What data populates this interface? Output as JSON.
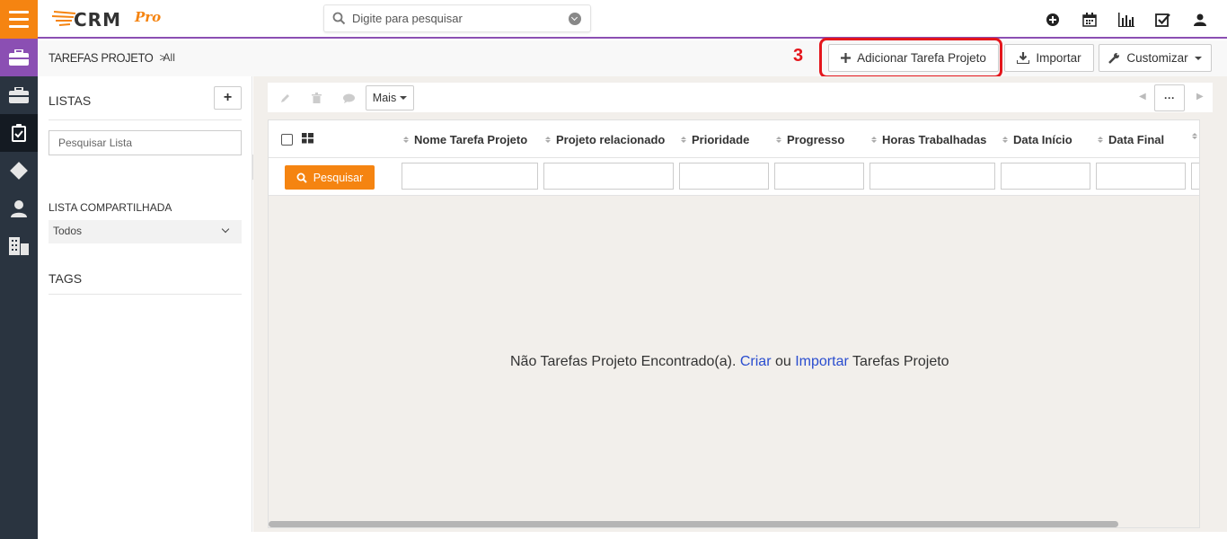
{
  "app": {
    "logo_text": "CRM",
    "logo_suffix": "Pro"
  },
  "search": {
    "placeholder": "Digite para pesquisar"
  },
  "header": {
    "title": "TAREFAS PROJETO",
    "breadcrumb_sep": ">",
    "breadcrumb_all": "All"
  },
  "annotation": {
    "step_number": "3",
    "color": "#e4161c"
  },
  "actions": {
    "add_label": "Adicionar Tarefa Projeto",
    "import_label": "Importar",
    "customize_label": "Customizar"
  },
  "sidebar": {
    "lists_label": "LISTAS",
    "add_symbol": "+",
    "search_list_placeholder": "Pesquisar Lista",
    "shared_list_label": "LISTA COMPARTILHADA",
    "shared_list_value": "Todos",
    "tags_label": "TAGS"
  },
  "toolbar": {
    "more_label": "Mais",
    "dots_label": "···"
  },
  "table": {
    "columns": [
      {
        "label": "Nome Tarefa Projeto"
      },
      {
        "label": "Projeto relacionado"
      },
      {
        "label": "Prioridade"
      },
      {
        "label": "Progresso"
      },
      {
        "label": "Horas Trabalhadas"
      },
      {
        "label": "Data Início"
      },
      {
        "label": "Data Final"
      }
    ],
    "search_button": "Pesquisar"
  },
  "empty_state": {
    "prefix": "Não Tarefas Projeto Encontrado(a).",
    "create_link": "Criar",
    "or": "ou",
    "import_link": "Importar",
    "suffix": "Tarefas Projeto"
  },
  "colors": {
    "accent_orange": "#f58411",
    "accent_purple": "#8b4fb3",
    "rail_dark": "#2a3440",
    "link_blue": "#2a4dcf"
  }
}
